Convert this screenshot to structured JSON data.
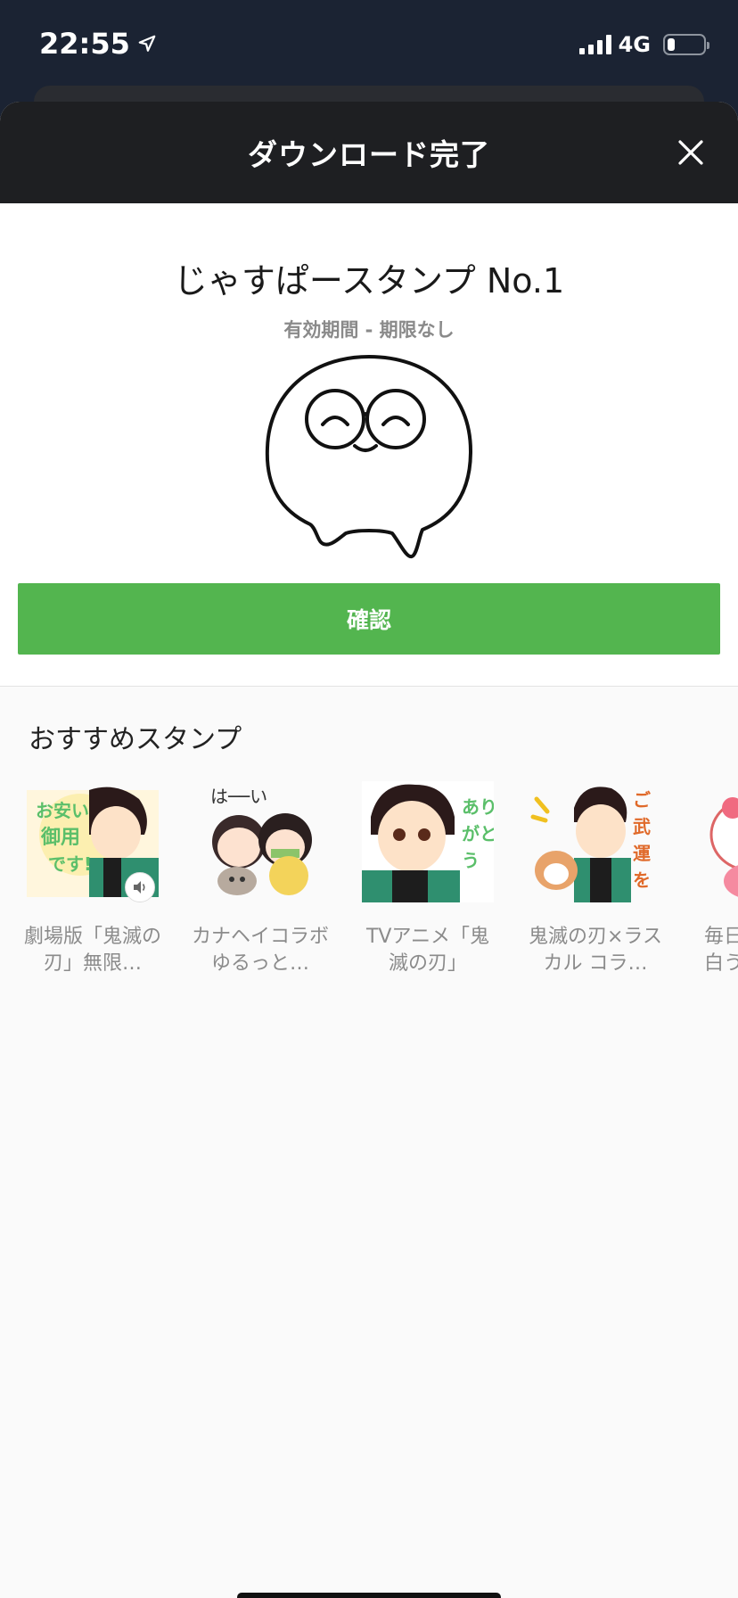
{
  "status_bar": {
    "time": "22:55",
    "network": "4G"
  },
  "modal": {
    "title": "ダウンロード完了",
    "close_icon": "close-icon"
  },
  "download": {
    "pack_name": "じゃすぱースタンプ No.1",
    "validity": "有効期間 - 期限なし",
    "confirm_label": "確認"
  },
  "recommend": {
    "title": "おすすめスタンプ",
    "items": [
      {
        "label": "劇場版「鬼滅の刃」無限…",
        "has_sound": true
      },
      {
        "label": "カナヘイコラボ ゆるっと…",
        "has_sound": false
      },
      {
        "label": "TVアニメ「鬼滅の刃」",
        "has_sound": false
      },
      {
        "label": "鬼滅の刃×ラスカル コラ…",
        "has_sound": false
      },
      {
        "label": "毎日白う",
        "has_sound": false
      }
    ]
  },
  "colors": {
    "accent_green": "#53b54f",
    "header_dark": "#1e1f22"
  }
}
